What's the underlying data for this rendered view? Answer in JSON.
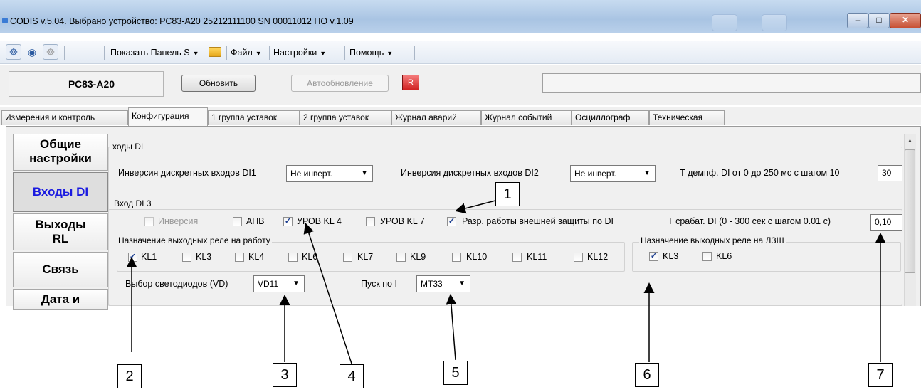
{
  "window": {
    "title": "CODIS v.5.04.  Выбрано устройство:  РС83-А20  25212111100  SN 00011012  ПО v.1.09",
    "minimize": "–",
    "maximize": "□",
    "close": "✕"
  },
  "toolbar": {
    "show_panel": "Показать Панель S",
    "file": "Файл",
    "settings": "Настройки",
    "help": "Помощь"
  },
  "devicebar": {
    "device": "РС83-А20",
    "refresh": "Обновить",
    "autorefresh": "Автообновление",
    "led": "R"
  },
  "tabs": [
    {
      "label": "Измерения и контроль"
    },
    {
      "label": "Конфигурация"
    },
    {
      "label": "1 группа уставок"
    },
    {
      "label": "2 группа уставок"
    },
    {
      "label": "Журнал аварий"
    },
    {
      "label": "Журнал событий"
    },
    {
      "label": "Осциллограф"
    },
    {
      "label": "Техническая"
    }
  ],
  "nav": {
    "general_1": "Общие",
    "general_2": "настройки",
    "inputs": "Входы DI",
    "outputs_1": "Выходы",
    "outputs_2": "RL",
    "comm": "Связь",
    "date": "Дата и"
  },
  "inputs_group": {
    "title": "ходы DI",
    "inv_di1_label": "Инверсия дискретных входов DI1",
    "inv_di1_value": "Не инверт.",
    "inv_di2_label": "Инверсия дискретных входов DI2",
    "inv_di2_value": "Не инверт.",
    "damp_label": "Т демпф. DI от 0 до 250 мс с шагом 10",
    "damp_value": "30"
  },
  "di3": {
    "title": "Вход DI 3",
    "inversion": "Инверсия",
    "apv": "АПВ",
    "urov_kl4": "УРОВ KL 4",
    "urov_kl7": "УРОВ KL 7",
    "ext_protect": "Разр. работы внешней защиты по DI",
    "trip_label": "Т срабат. DI (0 - 300 сек с шагом 0.01 с)",
    "trip_value": "0,10"
  },
  "relays": {
    "title": "Назначение выходных реле на работу",
    "items": [
      "KL1",
      "KL3",
      "KL4",
      "KL6",
      "KL7",
      "KL9",
      "KL10",
      "KL11",
      "KL12"
    ]
  },
  "lzsh": {
    "title": "Назначение выходных реле на ЛЗШ",
    "items": [
      "KL3",
      "KL6"
    ]
  },
  "leds": {
    "label": "Выбор светодиодов (VD)",
    "value": "VD11"
  },
  "start": {
    "label": "Пуск по I",
    "value": "MT33"
  },
  "callouts": [
    "1",
    "2",
    "3",
    "4",
    "5",
    "6",
    "7"
  ],
  "colors": {
    "titlebar": "#b9d0ea",
    "active_nav_text": "#1a1ae0",
    "panel_bg": "#f0f0f0"
  }
}
